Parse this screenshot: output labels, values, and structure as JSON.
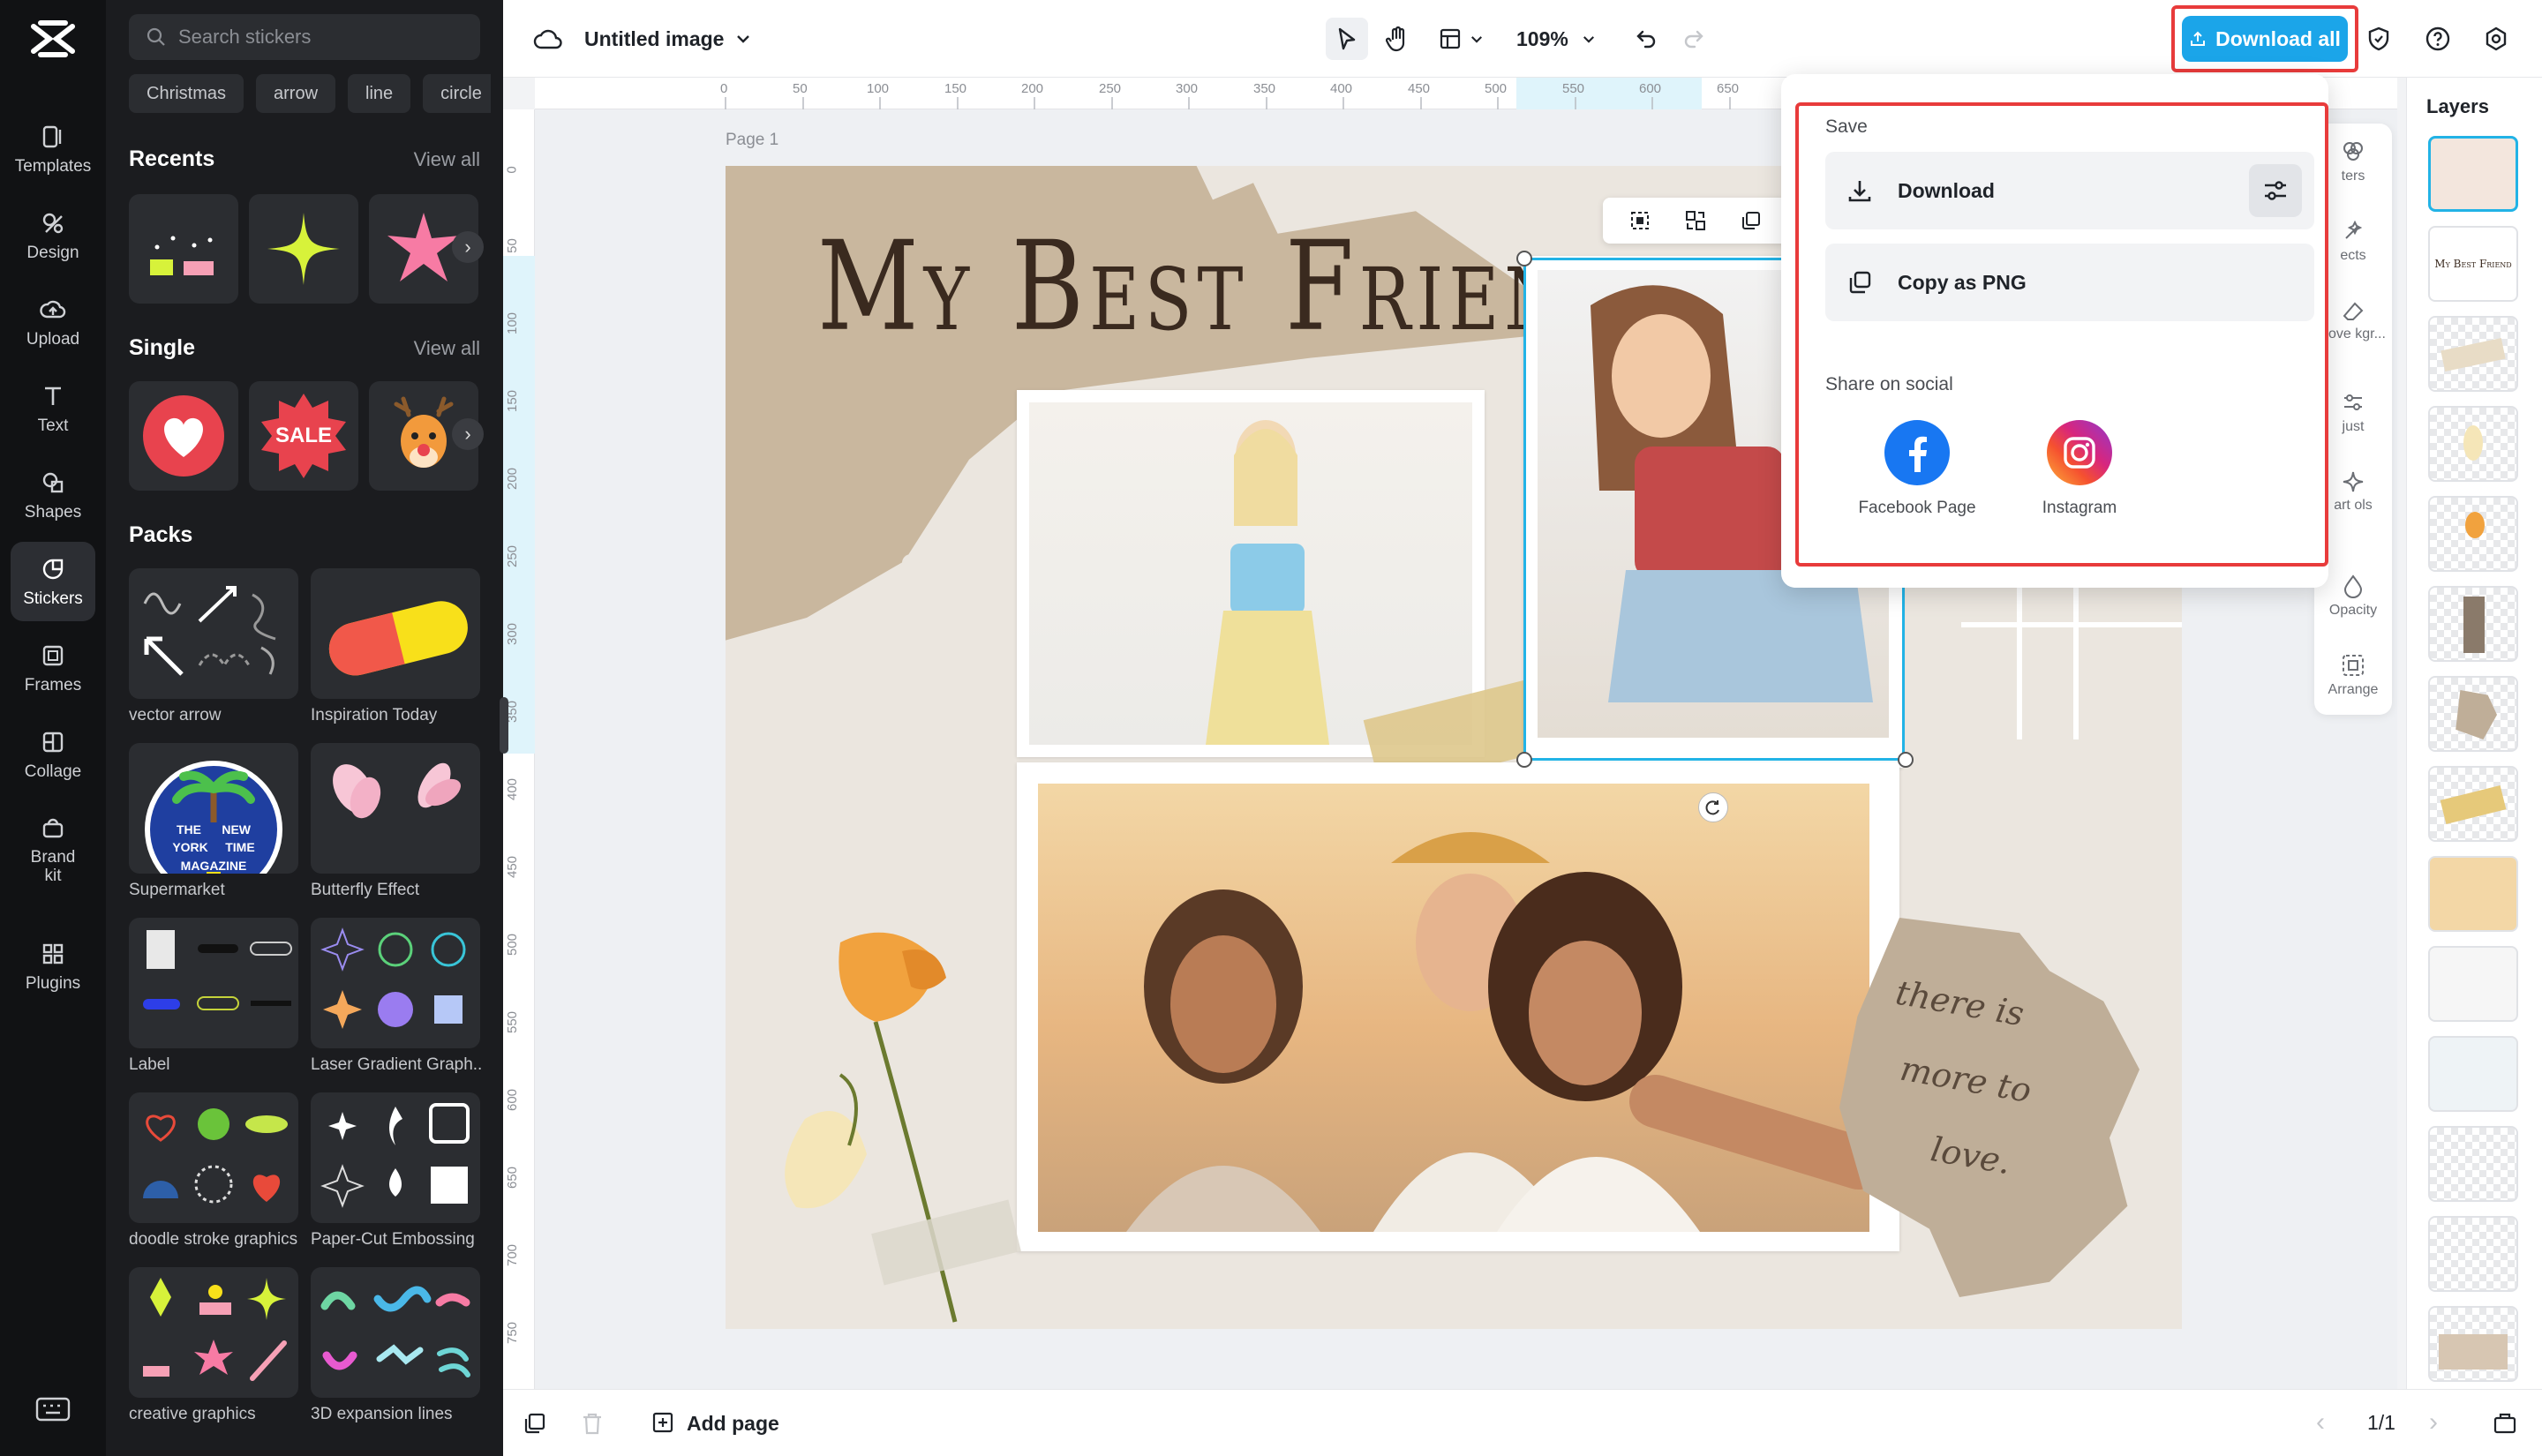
{
  "rail": {
    "items": [
      {
        "label": "Templates",
        "icon": "templates-icon"
      },
      {
        "label": "Design",
        "icon": "design-icon"
      },
      {
        "label": "Upload",
        "icon": "upload-icon"
      },
      {
        "label": "Text",
        "icon": "text-icon"
      },
      {
        "label": "Shapes",
        "icon": "shapes-icon"
      },
      {
        "label": "Stickers",
        "icon": "stickers-icon",
        "active": true
      },
      {
        "label": "Frames",
        "icon": "frames-icon"
      },
      {
        "label": "Collage",
        "icon": "collage-icon"
      },
      {
        "label": "Brand\nkit",
        "icon": "brand-kit-icon"
      },
      {
        "label": "Plugins",
        "icon": "plugins-icon"
      }
    ]
  },
  "panel": {
    "search_placeholder": "Search stickers",
    "chips": [
      "Christmas",
      "arrow",
      "line",
      "circle"
    ],
    "recents_title": "Recents",
    "single_title": "Single",
    "packs_title": "Packs",
    "view_all": "View all",
    "packs": [
      "vector arrow",
      "Inspiration Today",
      "Supermarket",
      "Butterfly Effect",
      "Label",
      "Laser Gradient Graph...",
      "doodle stroke graphics",
      "Paper-Cut Embossing",
      "creative graphics",
      "3D expansion lines"
    ],
    "sticker_texts": {
      "sale": "SALE",
      "badge_line1": "THE",
      "badge_line2": "NEW",
      "badge_line3": "YORK",
      "badge_line4": "TIME",
      "badge_line5": "MAGAZINE"
    }
  },
  "topbar": {
    "doc_title": "Untitled image",
    "zoom": "109%",
    "download_all": "Download all"
  },
  "ruler": {
    "top_ticks": [
      "0",
      "50",
      "100",
      "150",
      "200",
      "250",
      "300",
      "350",
      "400",
      "450",
      "500",
      "550",
      "600",
      "650"
    ],
    "left_ticks": [
      "0",
      "50",
      "100",
      "150",
      "200",
      "250",
      "300",
      "350",
      "400",
      "450",
      "500",
      "550",
      "600",
      "650",
      "700",
      "750"
    ]
  },
  "canvas": {
    "page_label": "Page 1",
    "headline": "My Best Friend",
    "note_line1": "there is",
    "note_line2": "more to",
    "note_line3": "love."
  },
  "popup": {
    "save_title": "Save",
    "download_label": "Download",
    "copy_label": "Copy as PNG",
    "share_title": "Share on social",
    "facebook_label": "Facebook Page",
    "instagram_label": "Instagram"
  },
  "tools": {
    "items": [
      "ters",
      "ects",
      "nove kgr...",
      "just",
      "art ols",
      "Opacity",
      "Arrange"
    ]
  },
  "layers": {
    "title": "Layers"
  },
  "bottombar": {
    "add_page": "Add page",
    "page_count": "1/1"
  },
  "colors": {
    "accent": "#1ba5e9",
    "highlight": "#e83b3b",
    "rail_bg": "#111214",
    "panel_bg": "#1b1c1f",
    "selection": "#22b3e6"
  }
}
